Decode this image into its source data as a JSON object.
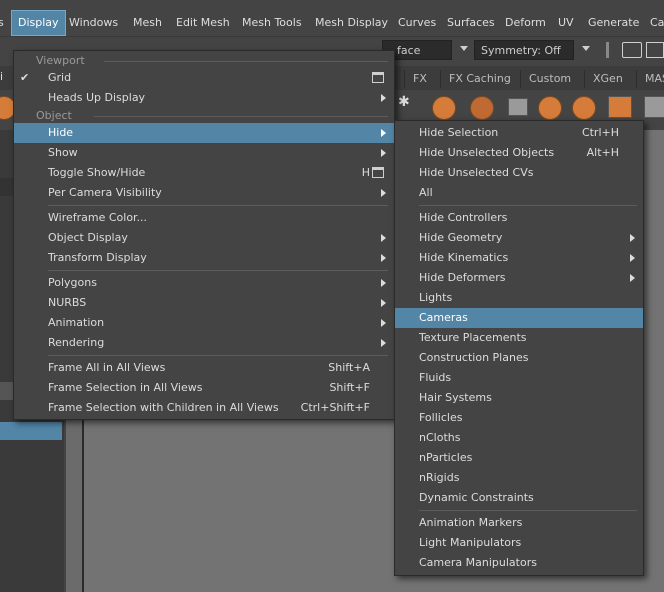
{
  "menubar": {
    "items": [
      "Display",
      "Windows",
      "Mesh",
      "Edit Mesh",
      "Mesh Tools",
      "Mesh Display",
      "Curves",
      "Surfaces",
      "Deform",
      "UV",
      "Generate",
      "Ca"
    ],
    "active": "Display"
  },
  "toolbar": {
    "face_field": "face",
    "symmetry": "Symmetry: Off"
  },
  "shelf_tabs": [
    "FX",
    "FX Caching",
    "Custom",
    "XGen",
    "MAS"
  ],
  "display_menu": {
    "section_viewport": "Viewport",
    "grid": "Grid",
    "heads_up": "Heads Up Display",
    "section_object": "Object",
    "hide": "Hide",
    "show": "Show",
    "toggle_show_hide": "Toggle Show/Hide",
    "toggle_shortcut": "H",
    "per_camera": "Per Camera Visibility",
    "wireframe_color": "Wireframe Color...",
    "object_display": "Object Display",
    "transform_display": "Transform Display",
    "polygons": "Polygons",
    "nurbs": "NURBS",
    "animation": "Animation",
    "rendering": "Rendering",
    "frame_all": "Frame All in All Views",
    "frame_all_sc": "Shift+A",
    "frame_sel": "Frame Selection in All Views",
    "frame_sel_sc": "Shift+F",
    "frame_sel_children": "Frame Selection with Children in All Views",
    "frame_sel_children_sc": "Ctrl+Shift+F"
  },
  "hide_menu": {
    "hide_selection": "Hide Selection",
    "hide_selection_sc": "Ctrl+H",
    "hide_unselected_objects": "Hide Unselected Objects",
    "hide_unselected_objects_sc": "Alt+H",
    "hide_unselected_cvs": "Hide Unselected CVs",
    "all": "All",
    "hide_controllers": "Hide Controllers",
    "hide_geometry": "Hide Geometry",
    "hide_kinematics": "Hide Kinematics",
    "hide_deformers": "Hide Deformers",
    "lights": "Lights",
    "cameras": "Cameras",
    "texture_placements": "Texture Placements",
    "construction_planes": "Construction Planes",
    "fluids": "Fluids",
    "hair_systems": "Hair Systems",
    "follicles": "Follicles",
    "ncloths": "nCloths",
    "nparticles": "nParticles",
    "nrigids": "nRigids",
    "dynamic_constraints": "Dynamic Constraints",
    "animation_markers": "Animation Markers",
    "light_manipulators": "Light Manipulators",
    "camera_manipulators": "Camera Manipulators"
  }
}
